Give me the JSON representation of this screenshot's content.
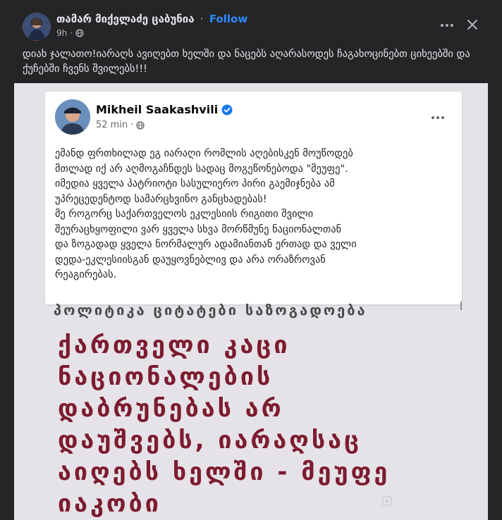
{
  "post": {
    "author_name": "თამარ მიქელაძე ცაბუნია",
    "separator": "·",
    "follow_label": "Follow",
    "time": "9h",
    "caption": "დიახ ჯალათო!იარაღს ავიღებთ ხელში და ნაცებს აღარასოდეს ჩაგახოცინებთ ციხეებში და ქუჩებში ჩვენს შვილებს!!!"
  },
  "shared_image": {
    "inner_post": {
      "author_name": "Mikheil Saakashvili",
      "time": "52 min",
      "text_lines": [
        "ემანდ ფრთხილად ეგ იარაღი რომლის აღებისკენ მოუწოდებ",
        "მთლად იქ არ აღმოგაჩნდეს სადაც მოგეწონებოდა \"მეუფე\".",
        "იმედია ყველა პატრიოტი სასულიერო პირი გაემიჯნება ამ",
        "უპრეცედენტოდ სამარცხვინო განცხადებას!",
        "მე როგორც საქართველოს ეკლესიის რიგითი შვილი",
        "შეურაცხყოფილი ვარ ყველა სხვა მორწმუნე ნაციონალთან",
        "და ზოგადად ყველა ნორმალურ ადამიანთან ერთად და ველი",
        "დედა-ეკლესიისგან დაუყოვნებლივ და არა ორაზროვან",
        "რეაგირებას."
      ]
    },
    "topics": "პოლიტიკა ციტატები საზოგადოება",
    "headline_lines": [
      "ქართველი კაცი",
      "ნაციონალების",
      "დაბრუნებას არ",
      "დაუშვებს, იარაღსაც",
      "აიღებს ხელში - მეუფე",
      "იაკობი"
    ]
  }
}
